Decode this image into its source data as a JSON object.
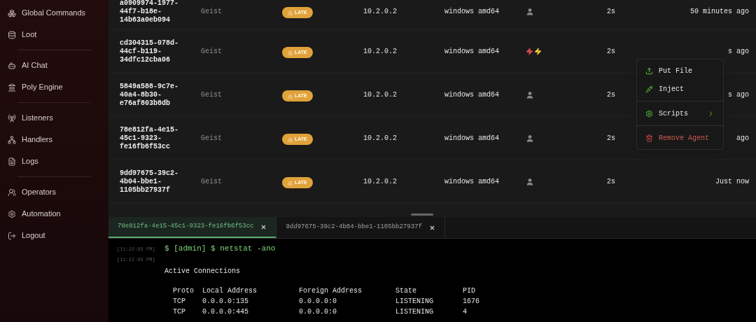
{
  "sidebar": {
    "sections": [
      {
        "items": [
          {
            "label": "Global Commands"
          },
          {
            "label": "Loot"
          }
        ]
      },
      {
        "items": [
          {
            "label": "AI Chat"
          },
          {
            "label": "Poly Engine"
          }
        ]
      },
      {
        "items": [
          {
            "label": "Listeners"
          },
          {
            "label": "Handlers"
          },
          {
            "label": "Logs"
          }
        ]
      },
      {
        "items": [
          {
            "label": "Operators"
          },
          {
            "label": "Automation"
          },
          {
            "label": "Logout"
          }
        ]
      }
    ]
  },
  "agents": {
    "rows": [
      {
        "id": "a0909974-1977-\n44f7-b18e-\n14b63a0eb094",
        "name": "Geist",
        "status": "LATE",
        "ip": "10.2.0.2",
        "os": "windows amd64",
        "kind": "user",
        "sleep": "2s",
        "last_seen": "50 minutes ago"
      },
      {
        "id": "cd304315-078d-\n44cf-b119-\n34dfc12cba06",
        "name": "Geist",
        "status": "LATE",
        "ip": "10.2.0.2",
        "os": "windows amd64",
        "kind": "elevated",
        "sleep": "2s",
        "last_seen": "s ago"
      },
      {
        "id": "5849a588-9c7e-\n40a4-8b30-\ne76af803b8db",
        "name": "Geist",
        "status": "LATE",
        "ip": "10.2.0.2",
        "os": "windows amd64",
        "kind": "user",
        "sleep": "2s",
        "last_seen": "s ago"
      },
      {
        "id": "78e812fa-4e15-\n45c1-9323-\nfe16fb6f53cc",
        "name": "Geist",
        "status": "LATE",
        "ip": "10.2.0.2",
        "os": "windows amd64",
        "kind": "user",
        "sleep": "2s",
        "last_seen": "ago"
      },
      {
        "id": "9dd97675-39c2-\n4b04-bbe1-\n1105bb27937f",
        "name": "Geist",
        "status": "LATE",
        "ip": "10.2.0.2",
        "os": "windows amd64",
        "kind": "user",
        "sleep": "2s",
        "last_seen": "Just now"
      }
    ]
  },
  "context_menu": {
    "sections": [
      {
        "items": [
          {
            "label": "Put File",
            "kind": "upload"
          },
          {
            "label": "Inject",
            "kind": "inject"
          }
        ]
      },
      {
        "items": [
          {
            "label": "Scripts",
            "kind": "submenu"
          }
        ]
      },
      {
        "items": [
          {
            "label": "Remove Agent",
            "kind": "danger"
          }
        ]
      }
    ]
  },
  "console": {
    "tabs": [
      {
        "label": "78e812fa-4e15-45c1-9323-fe16fb6f53cc",
        "selected": true
      },
      {
        "label": "9dd97675-39c2-4b04-bbe1-1105bb27937f",
        "selected": false
      }
    ],
    "entries": [
      {
        "kind": "command",
        "time": "[11:22:03 PM]",
        "text": "$ [admin] $ netstat -ano"
      },
      {
        "kind": "output",
        "time": "[11:22:03 PM]",
        "paragraphs": [
          [
            "Active Connections"
          ],
          [
            "  Proto  Local Address          Foreign Address        State           PID",
            "  TCP    0.0.0.0:135            0.0.0.0:0              LISTENING       1676",
            "  TCP    0.0.0.0:445            0.0.0.0:0              LISTENING       4"
          ]
        ]
      }
    ]
  }
}
